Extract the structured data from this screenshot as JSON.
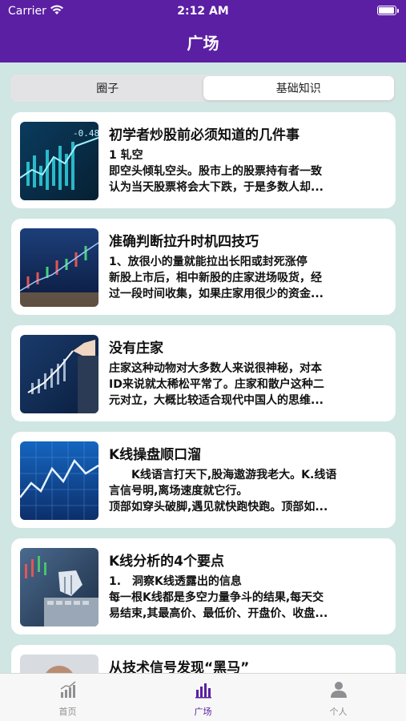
{
  "status_bar": {
    "carrier": "Carrier",
    "time": "2:12 AM",
    "battery_level": 1.0
  },
  "nav": {
    "title": "广场"
  },
  "segments": {
    "items": [
      {
        "label": "圈子",
        "selected": false
      },
      {
        "label": "基础知识",
        "selected": true
      }
    ]
  },
  "articles": [
    {
      "title": "初学者炒股前必须知道的几件事",
      "lines": [
        "1 轧空",
        "即空头倾轧空头。股市上的股票持有者一致",
        "认为当天股票将会大下跌，于是多数人却..."
      ],
      "thumb_icon": "stock-chart-blue-thumbnail"
    },
    {
      "title": "准确判断拉升时机四技巧",
      "lines": [
        "1、放很小的量就能拉出长阳或封死涨停",
        "新股上市后，相中新股的庄家进场吸货，经",
        "过一段时间收集，如果庄家用很少的资金..."
      ],
      "thumb_icon": "candlestick-chart-thumbnail"
    },
    {
      "title": "没有庄家",
      "lines": [
        "庄家这种动物对大多数人来说很神秘，对本",
        "ID来说就太稀松平常了。庄家和散户这种二",
        "元对立，大概比较适合现代中国人的思维..."
      ],
      "thumb_icon": "hand-drawing-chart-thumbnail"
    },
    {
      "title": "K线操盘顺口溜",
      "lines": [
        "　　K线语言打天下,股海遨游我老大。K.线语",
        "言信号明,离场速度就它行。",
        "顶部如穿头破脚,遇见就快跑快跑。顶部如..."
      ],
      "thumb_icon": "blue-line-chart-thumbnail"
    },
    {
      "title": "K线分析的4个要点",
      "lines": [
        "1.　洞察K线透露出的信息",
        "每一根K线都是多空力量争斗的结果,每天交",
        "易结束,其最高价、最低价、开盘价、收盘..."
      ],
      "thumb_icon": "robot-hand-keyboard-thumbnail"
    },
    {
      "title": "从技术信号发现“黑马”",
      "lines": [],
      "thumb_icon": "person-photo-thumbnail"
    }
  ],
  "tab_bar": {
    "tabs": [
      {
        "label": "首页",
        "icon": "chart-growth-icon",
        "active": false
      },
      {
        "label": "广场",
        "icon": "bar-chart-icon",
        "active": true
      },
      {
        "label": "个人",
        "icon": "person-icon",
        "active": false
      }
    ]
  },
  "colors": {
    "brand_purple": "#5b1fa3",
    "background": "#cfe6e3",
    "active_tab": "#5b1fa3",
    "inactive_tab": "#8e8e93"
  }
}
